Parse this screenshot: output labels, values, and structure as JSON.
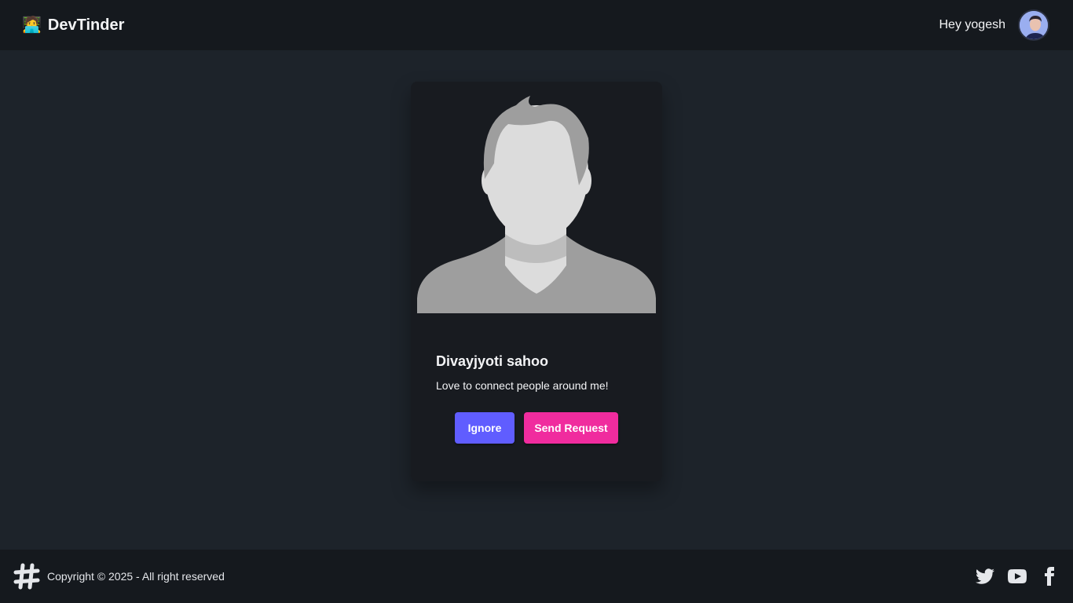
{
  "header": {
    "brand_emoji": "🧑‍💻",
    "brand_name": "DevTinder",
    "greeting": "Hey yogesh"
  },
  "profile_card": {
    "name": "Divayjyoti sahoo",
    "about": "Love to connect people around me!",
    "ignore_label": "Ignore",
    "send_label": "Send Request"
  },
  "footer": {
    "copyright": "Copyright © 2025 - All right reserved",
    "socials": [
      "twitter-icon",
      "youtube-icon",
      "facebook-icon"
    ]
  },
  "colors": {
    "ignore_button": "#605dff",
    "send_button": "#f02c9e",
    "navbar_bg": "#15191e",
    "page_bg": "#1d232a"
  }
}
